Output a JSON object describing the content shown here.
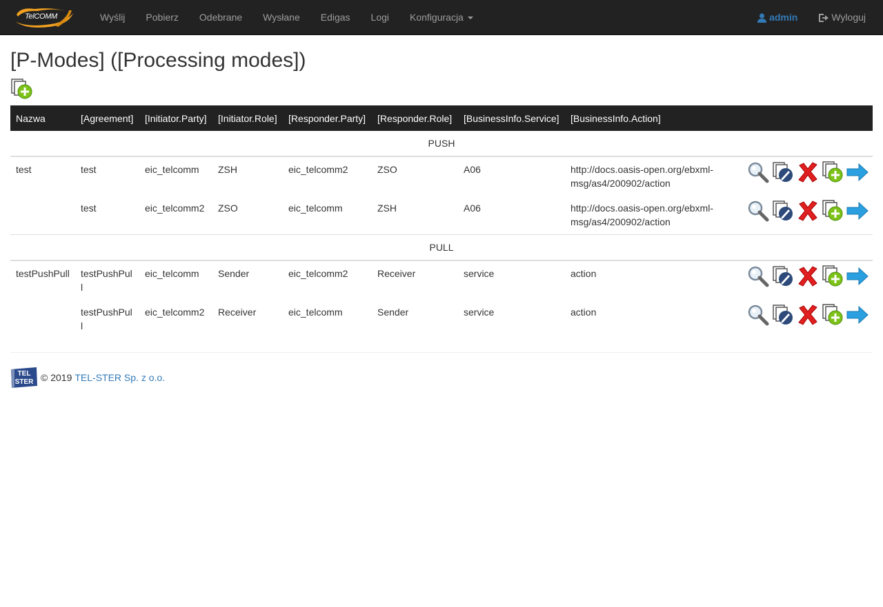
{
  "navbar": {
    "brand_text": "TelCOMM",
    "items": [
      "Wyślij",
      "Pobierz",
      "Odebrane",
      "Wysłane",
      "Edigas",
      "Logi",
      "Konfiguracja"
    ],
    "user": "admin",
    "logout": "Wyloguj"
  },
  "page": {
    "title": "[P-Modes] ([Processing modes])"
  },
  "table": {
    "headers": [
      "Nazwa",
      "[Agreement]",
      "[Initiator.Party]",
      "[Initiator.Role]",
      "[Responder.Party]",
      "[Responder.Role]",
      "[BusinessInfo.Service]",
      "[BusinessInfo.Action]"
    ],
    "groups": [
      {
        "label": "PUSH",
        "rows": [
          {
            "name": "test",
            "agreement": "test",
            "initiator_party": "eic_telcomm",
            "initiator_role": "ZSH",
            "responder_party": "eic_telcomm2",
            "responder_role": "ZSO",
            "service": "A06",
            "action": "http://docs.oasis-open.org/ebxml-msg/as4/200902/action"
          },
          {
            "name": "",
            "agreement": "test",
            "initiator_party": "eic_telcomm2",
            "initiator_role": "ZSO",
            "responder_party": "eic_telcomm",
            "responder_role": "ZSH",
            "service": "A06",
            "action": "http://docs.oasis-open.org/ebxml-msg/as4/200902/action"
          }
        ]
      },
      {
        "label": "PULL",
        "rows": [
          {
            "name": "testPushPull",
            "agreement": "testPushPull",
            "initiator_party": "eic_telcomm",
            "initiator_role": "Sender",
            "responder_party": "eic_telcomm2",
            "responder_role": "Receiver",
            "service": "service",
            "action": "action"
          },
          {
            "name": "",
            "agreement": "testPushPull",
            "initiator_party": "eic_telcomm2",
            "initiator_role": "Receiver",
            "responder_party": "eic_telcomm",
            "responder_role": "Sender",
            "service": "service",
            "action": "action"
          }
        ]
      }
    ],
    "row_actions": [
      "view-icon",
      "edit-icon",
      "delete-icon",
      "copy-add-icon",
      "arrow-right-icon"
    ]
  },
  "footer": {
    "logo_text_top": "TEL",
    "logo_text_bottom": "STER",
    "copyright": "© 2019",
    "company": "TEL-STER Sp. z o.o."
  }
}
